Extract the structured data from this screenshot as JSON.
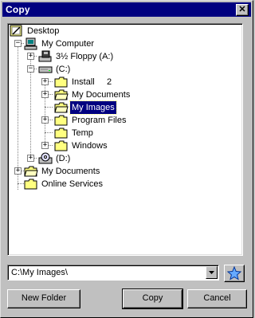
{
  "window": {
    "title": "Copy",
    "close_glyph": "✕"
  },
  "tree": {
    "nodes": [
      {
        "label": "Desktop",
        "icon": "desktop-icon"
      },
      {
        "label": "My Computer",
        "icon": "computer-icon",
        "expander": "−"
      },
      {
        "label": "3½ Floppy (A:)",
        "icon": "floppy-drive-icon",
        "expander": "+"
      },
      {
        "label": "(C:)",
        "icon": "hard-drive-icon",
        "expander": "−"
      },
      {
        "label": "Install     2",
        "icon": "folder-icon",
        "expander": "+"
      },
      {
        "label": "My Documents",
        "icon": "open-folder-icon",
        "expander": "+"
      },
      {
        "label": "My Images",
        "icon": "open-folder-icon",
        "selected": true
      },
      {
        "label": "Program Files",
        "icon": "folder-icon",
        "expander": "+"
      },
      {
        "label": "Temp",
        "icon": "folder-icon"
      },
      {
        "label": "Windows",
        "icon": "folder-icon",
        "expander": "+"
      },
      {
        "label": "(D:)",
        "icon": "cd-drive-icon",
        "expander": "+"
      },
      {
        "label": "My Documents",
        "icon": "open-folder-icon",
        "expander": "+"
      },
      {
        "label": "Online Services",
        "icon": "folder-icon"
      }
    ]
  },
  "path_box": {
    "value": "C:\\My Images\\",
    "dropdown_glyph": "▼"
  },
  "favorites_button": {
    "icon": "star-icon"
  },
  "buttons": {
    "new_folder": "New Folder",
    "copy": "Copy",
    "cancel": "Cancel"
  },
  "colors": {
    "title_bar": "#000080",
    "selection": "#000080",
    "face": "#c0c0c0",
    "folder": "#ffff80"
  }
}
